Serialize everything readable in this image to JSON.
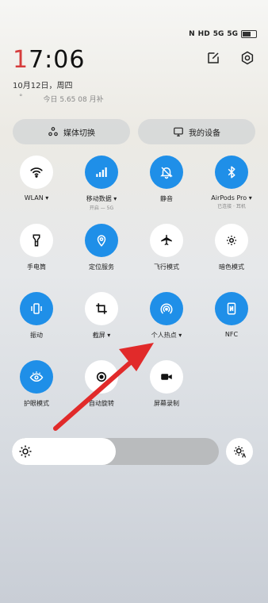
{
  "status_bar": {
    "indicators": [
      "N",
      "HD",
      "5G",
      "5G"
    ],
    "battery_icon": "battery-icon"
  },
  "clock": {
    "time": "17:06",
    "date": "10月12日，周四"
  },
  "weather": {
    "temp": "°",
    "text": "今日 5.65 08 月补"
  },
  "header_icons": [
    "edit-icon",
    "settings-icon"
  ],
  "pills": {
    "media": {
      "label": "媒体切换",
      "icon": "media-switch-icon"
    },
    "devices": {
      "label": "我的设备",
      "icon": "devices-icon"
    }
  },
  "tiles": [
    {
      "label": "WLAN ▾",
      "sub": "",
      "icon": "wifi-icon",
      "on": false
    },
    {
      "label": "移动数据 ▾",
      "sub": "开启 — 5G",
      "icon": "signal-icon",
      "on": true
    },
    {
      "label": "静音",
      "sub": "",
      "icon": "bell-mute-icon",
      "on": true
    },
    {
      "label": "AirPods Pro ▾",
      "sub": "已连接 · 耳机",
      "icon": "bluetooth-icon",
      "on": true
    },
    {
      "label": "手电筒",
      "sub": "",
      "icon": "flashlight-icon",
      "on": false
    },
    {
      "label": "定位服务",
      "sub": "",
      "icon": "location-icon",
      "on": true
    },
    {
      "label": "飞行模式",
      "sub": "",
      "icon": "airplane-icon",
      "on": false
    },
    {
      "label": "暗色模式",
      "sub": "",
      "icon": "dark-mode-icon",
      "on": false
    },
    {
      "label": "振动",
      "sub": "",
      "icon": "vibrate-icon",
      "on": true
    },
    {
      "label": "截屏 ▾",
      "sub": "",
      "icon": "crop-icon",
      "on": false
    },
    {
      "label": "个人热点 ▾",
      "sub": "",
      "icon": "hotspot-icon",
      "on": true
    },
    {
      "label": "NFC",
      "sub": "",
      "icon": "nfc-icon",
      "on": true
    },
    {
      "label": "护眼模式",
      "sub": "",
      "icon": "eye-icon",
      "on": true
    },
    {
      "label": "自动旋转",
      "sub": "",
      "icon": "rotate-icon",
      "on": false
    },
    {
      "label": "屏幕录制",
      "sub": "",
      "icon": "video-icon",
      "on": false
    }
  ],
  "brightness": {
    "level": 0.5,
    "icon": "sun-icon",
    "auto_icon": "auto-brightness-icon"
  },
  "annotation": {
    "icon": "red-arrow-icon",
    "color": "#e12a2a"
  },
  "colors": {
    "accent": "#1f8fe8",
    "hour_digit": "#d63c3c"
  }
}
